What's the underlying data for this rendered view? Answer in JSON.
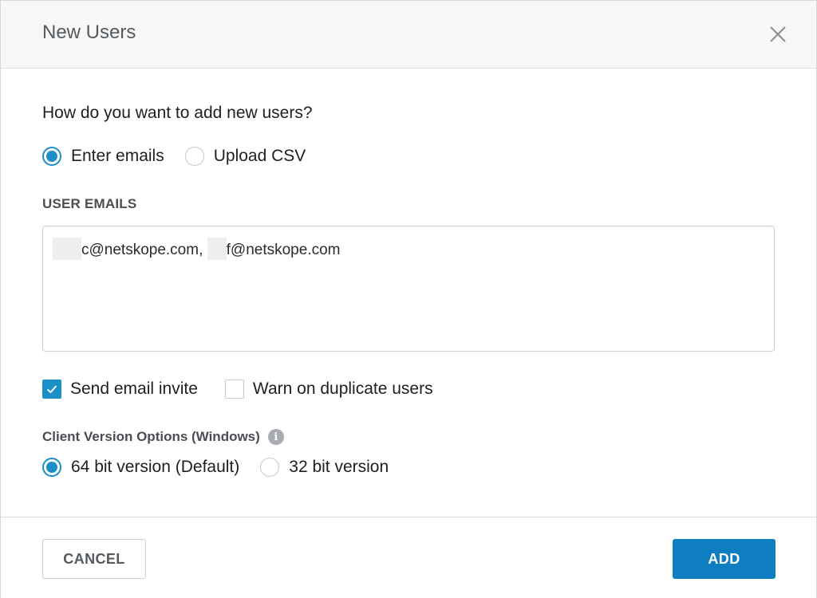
{
  "dialog": {
    "title": "New Users",
    "close_icon": "close-icon"
  },
  "add_method": {
    "question": "How do you want to add new users?",
    "options": [
      {
        "label": "Enter emails",
        "checked": true
      },
      {
        "label": "Upload CSV",
        "checked": false
      }
    ]
  },
  "user_emails": {
    "label": "USER EMAILS",
    "value_part1": "c@netskope.com, ",
    "value_part2": "f@netskope.com"
  },
  "invite_options": [
    {
      "label": "Send email invite",
      "checked": true
    },
    {
      "label": "Warn on duplicate users",
      "checked": false
    }
  ],
  "client_version": {
    "label": "Client Version Options (Windows)",
    "info_icon": "info-icon",
    "info_glyph": "i",
    "options": [
      {
        "label": "64 bit version (Default)",
        "checked": true
      },
      {
        "label": "32 bit version",
        "checked": false
      }
    ]
  },
  "footer": {
    "cancel_label": "CANCEL",
    "add_label": "ADD"
  },
  "colors": {
    "accent": "#1b8fc7",
    "primary_button": "#0f7ec0"
  }
}
